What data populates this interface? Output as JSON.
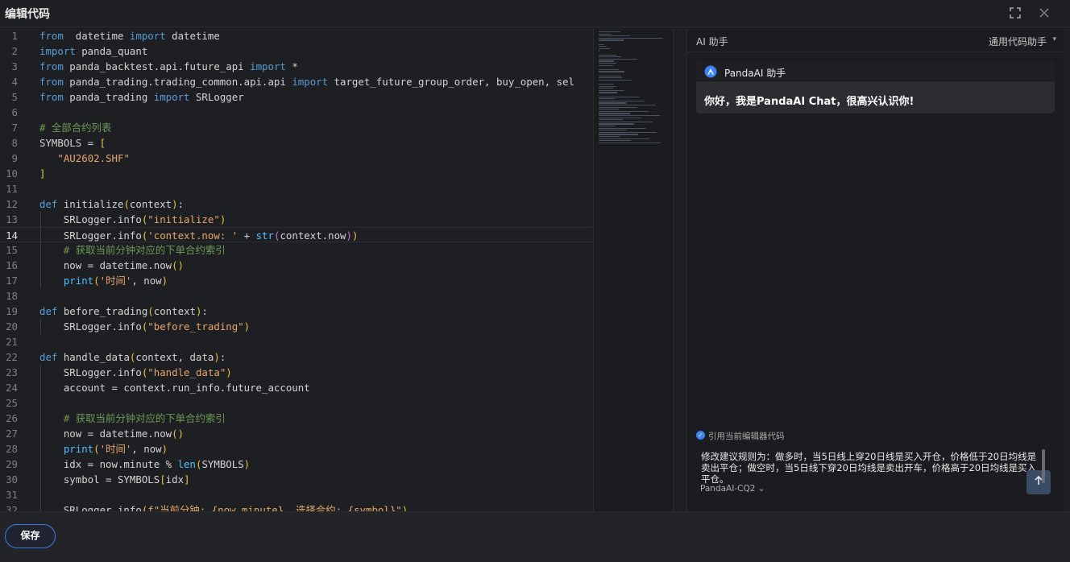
{
  "window": {
    "title": "编辑代码",
    "expand_icon": "expand-icon",
    "close_icon": "close-icon"
  },
  "editor": {
    "active_line": 14,
    "lines": [
      {
        "n": "1",
        "segs": [
          [
            "kw",
            "from"
          ],
          [
            "",
            "  datetime "
          ],
          [
            "kw",
            "import"
          ],
          [
            "",
            " datetime"
          ]
        ]
      },
      {
        "n": "2",
        "segs": [
          [
            "kw",
            "import"
          ],
          [
            "",
            " panda_quant"
          ]
        ]
      },
      {
        "n": "3",
        "segs": [
          [
            "kw",
            "from"
          ],
          [
            "",
            " panda_backtest.api.future_api "
          ],
          [
            "kw",
            "import"
          ],
          [
            "",
            " *"
          ]
        ]
      },
      {
        "n": "4",
        "segs": [
          [
            "kw",
            "from"
          ],
          [
            "",
            " panda_trading.trading_common.api.api "
          ],
          [
            "kw",
            "import"
          ],
          [
            "",
            " target_future_group_order, buy_open, sel"
          ]
        ]
      },
      {
        "n": "5",
        "segs": [
          [
            "kw",
            "from"
          ],
          [
            "",
            " panda_trading "
          ],
          [
            "kw",
            "import"
          ],
          [
            "",
            " SRLogger"
          ]
        ]
      },
      {
        "n": "6",
        "segs": []
      },
      {
        "n": "7",
        "segs": [
          [
            "cm",
            "# 全部合约列表"
          ]
        ]
      },
      {
        "n": "8",
        "segs": [
          [
            "",
            "SYMBOLS = "
          ],
          [
            "br",
            "["
          ]
        ]
      },
      {
        "n": "9",
        "segs": [
          [
            "",
            "   "
          ],
          [
            "str",
            "\"AU2602.SHF\""
          ]
        ]
      },
      {
        "n": "10",
        "segs": [
          [
            "br",
            "]"
          ]
        ]
      },
      {
        "n": "11",
        "segs": []
      },
      {
        "n": "12",
        "segs": [
          [
            "kw",
            "def"
          ],
          [
            "",
            " initialize"
          ],
          [
            "br",
            "("
          ],
          [
            "",
            "context"
          ],
          [
            "br",
            ")"
          ],
          [
            "",
            ":"
          ]
        ]
      },
      {
        "n": "13",
        "segs": [
          [
            "",
            "    SRLogger.info"
          ],
          [
            "br",
            "("
          ],
          [
            "str",
            "\"initialize\""
          ],
          [
            "br",
            ")"
          ]
        ]
      },
      {
        "n": "14",
        "segs": [
          [
            "",
            "    SRLogger.info"
          ],
          [
            "br",
            "("
          ],
          [
            "str",
            "'context.now: '"
          ],
          [
            "",
            " + "
          ],
          [
            "fn",
            "str"
          ],
          [
            "brp",
            "("
          ],
          [
            "",
            "context.now"
          ],
          [
            "brp",
            ")"
          ],
          [
            "br",
            ")"
          ]
        ]
      },
      {
        "n": "15",
        "segs": [
          [
            "cm",
            "    # 获取当前分钟对应的下单合约索引"
          ]
        ]
      },
      {
        "n": "16",
        "segs": [
          [
            "",
            "    now = datetime.now"
          ],
          [
            "br",
            "()"
          ]
        ]
      },
      {
        "n": "17",
        "segs": [
          [
            "fn",
            "    print"
          ],
          [
            "br",
            "("
          ],
          [
            "str",
            "'时间'"
          ],
          [
            "",
            ", now"
          ],
          [
            "br",
            ")"
          ]
        ]
      },
      {
        "n": "18",
        "segs": []
      },
      {
        "n": "19",
        "segs": [
          [
            "kw",
            "def"
          ],
          [
            "",
            " before_trading"
          ],
          [
            "br",
            "("
          ],
          [
            "",
            "context"
          ],
          [
            "br",
            ")"
          ],
          [
            "",
            ":"
          ]
        ]
      },
      {
        "n": "20",
        "segs": [
          [
            "",
            "    SRLogger.info"
          ],
          [
            "br",
            "("
          ],
          [
            "str",
            "\"before_trading\""
          ],
          [
            "br",
            ")"
          ]
        ]
      },
      {
        "n": "21",
        "segs": []
      },
      {
        "n": "22",
        "segs": [
          [
            "kw",
            "def"
          ],
          [
            "",
            " handle_data"
          ],
          [
            "br",
            "("
          ],
          [
            "",
            "context, data"
          ],
          [
            "br",
            ")"
          ],
          [
            "",
            ":"
          ]
        ]
      },
      {
        "n": "23",
        "segs": [
          [
            "",
            "    SRLogger.info"
          ],
          [
            "br",
            "("
          ],
          [
            "str",
            "\"handle_data\""
          ],
          [
            "br",
            ")"
          ]
        ]
      },
      {
        "n": "24",
        "segs": [
          [
            "",
            "    account = context.run_info.future_account"
          ]
        ]
      },
      {
        "n": "25",
        "segs": []
      },
      {
        "n": "26",
        "segs": [
          [
            "cm",
            "    # 获取当前分钟对应的下单合约索引"
          ]
        ]
      },
      {
        "n": "27",
        "segs": [
          [
            "",
            "    now = datetime.now"
          ],
          [
            "br",
            "()"
          ]
        ]
      },
      {
        "n": "28",
        "segs": [
          [
            "fn",
            "    print"
          ],
          [
            "br",
            "("
          ],
          [
            "str",
            "'时间'"
          ],
          [
            "",
            ", now"
          ],
          [
            "br",
            ")"
          ]
        ]
      },
      {
        "n": "29",
        "segs": [
          [
            "",
            "    idx = now.minute % "
          ],
          [
            "fn",
            "len"
          ],
          [
            "br",
            "("
          ],
          [
            "",
            "SYMBOLS"
          ],
          [
            "br",
            ")"
          ]
        ]
      },
      {
        "n": "30",
        "segs": [
          [
            "",
            "    symbol = SYMBOLS"
          ],
          [
            "br",
            "["
          ],
          [
            "",
            "idx"
          ],
          [
            "br",
            "]"
          ]
        ]
      },
      {
        "n": "31",
        "segs": []
      },
      {
        "n": "32",
        "segs": [
          [
            "",
            "    SRLogger.info"
          ],
          [
            "br",
            "("
          ],
          [
            "str",
            "f\"当前分钟: {now.minute}, 选择合约: {symbol}\""
          ],
          [
            "br",
            ")"
          ]
        ]
      }
    ]
  },
  "ai": {
    "title": "AI 助手",
    "mode": "通用代码助手",
    "chat_title": "PandaAI 助手",
    "greeting": "你好，我是PandaAI Chat，很高兴认识你!",
    "cite_label": "引用当前编辑器代码",
    "input_text": "修改建议规则为：做多时，当5日线上穿20日线是买入开仓，价格低于20日均线是卖出平仓；做空时，当5日线下穿20日均线是卖出开车，价格高于20日均线是买入平仓。",
    "model": "PandaAI-CQ2",
    "send_icon": "arrow-up-icon"
  },
  "footer": {
    "save_label": "保存"
  },
  "colors": {
    "accent": "#3b7be0",
    "keyword": "#569cd6",
    "string": "#e6a76a",
    "comment": "#6a9955"
  }
}
